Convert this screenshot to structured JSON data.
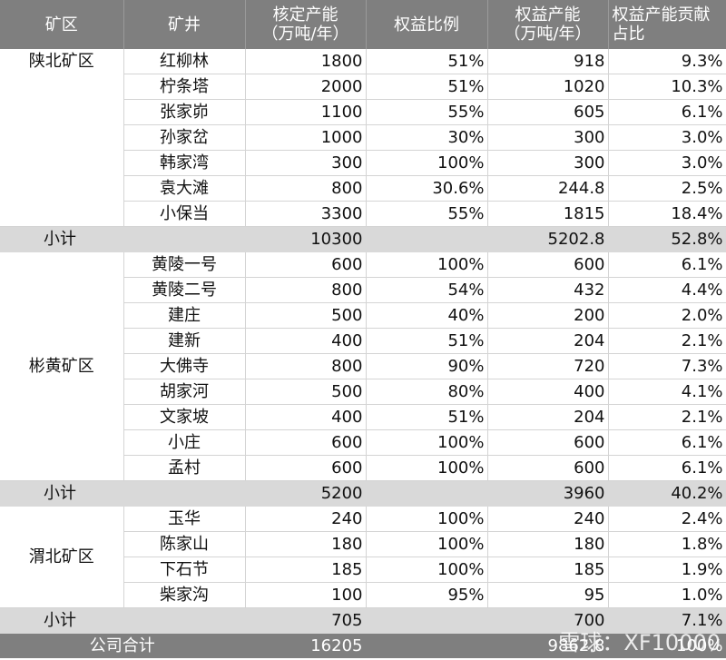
{
  "headers": [
    "矿区",
    "矿井",
    "核定产能\n（万吨/年）",
    "权益比例",
    "权益产能\n（万吨/年）",
    "权益产能贡献占比"
  ],
  "groups": [
    {
      "area": "陕北矿区",
      "rows": [
        [
          "红柳林",
          "1800",
          "51%",
          "918",
          "9.3%"
        ],
        [
          "柠条塔",
          "2000",
          "51%",
          "1020",
          "10.3%"
        ],
        [
          "张家峁",
          "1100",
          "55%",
          "605",
          "6.1%"
        ],
        [
          "孙家岔",
          "1000",
          "30%",
          "300",
          "3.0%"
        ],
        [
          "韩家湾",
          "300",
          "100%",
          "300",
          "3.0%"
        ],
        [
          "袁大滩",
          "800",
          "30.6%",
          "244.8",
          "2.5%"
        ],
        [
          "小保当",
          "3300",
          "55%",
          "1815",
          "18.4%"
        ]
      ],
      "subtotal": {
        "label": "小计",
        "capacity": "10300",
        "equity": "5202.8",
        "share": "52.8%"
      }
    },
    {
      "area": "彬黄矿区",
      "rows": [
        [
          "黄陵一号",
          "600",
          "100%",
          "600",
          "6.1%"
        ],
        [
          "黄陵二号",
          "800",
          "54%",
          "432",
          "4.4%"
        ],
        [
          "建庄",
          "500",
          "40%",
          "200",
          "2.0%"
        ],
        [
          "建新",
          "400",
          "51%",
          "204",
          "2.1%"
        ],
        [
          "大佛寺",
          "800",
          "90%",
          "720",
          "7.3%"
        ],
        [
          "胡家河",
          "500",
          "80%",
          "400",
          "4.1%"
        ],
        [
          "文家坡",
          "400",
          "51%",
          "204",
          "2.1%"
        ],
        [
          "小庄",
          "600",
          "100%",
          "600",
          "6.1%"
        ],
        [
          "孟村",
          "600",
          "100%",
          "600",
          "6.1%"
        ]
      ],
      "subtotal": {
        "label": "小计",
        "capacity": "5200",
        "equity": "3960",
        "share": "40.2%"
      }
    },
    {
      "area": "渭北矿区",
      "rows": [
        [
          "玉华",
          "240",
          "100%",
          "240",
          "2.4%"
        ],
        [
          "陈家山",
          "180",
          "100%",
          "180",
          "1.8%"
        ],
        [
          "下石节",
          "185",
          "100%",
          "185",
          "1.9%"
        ],
        [
          "柴家沟",
          "100",
          "95%",
          "95",
          "1.0%"
        ]
      ],
      "subtotal": {
        "label": "小计",
        "capacity": "705",
        "equity": "700",
        "share": "7.1%"
      }
    }
  ],
  "total": {
    "label": "公司合计",
    "capacity": "16205",
    "equity": "9862.8",
    "share": "100%"
  },
  "watermark": "雪球：XF10000"
}
